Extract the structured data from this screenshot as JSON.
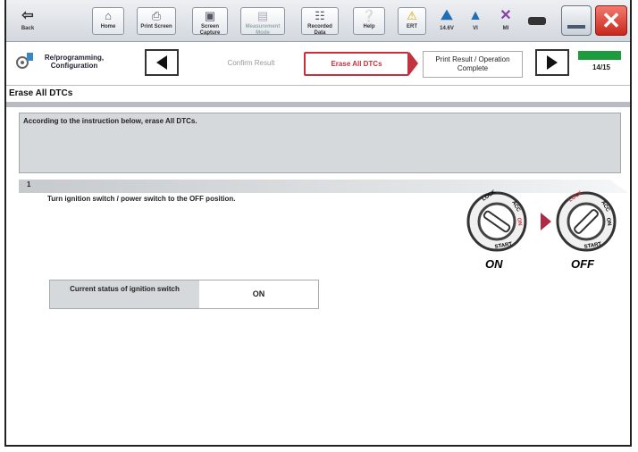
{
  "toolbar": {
    "back_label": "Back",
    "home_label": "Home",
    "print_screen_label": "Print Screen",
    "screen_capture_label": "Screen Capture",
    "measurement_mode_label": "Measurement Mode",
    "recorded_data_label": "Recorded Data",
    "help_label": "Help",
    "ert_label": "ERT",
    "voltage_label": "14.6V",
    "vi_label": "VI",
    "mi_label": "MI"
  },
  "stepnav": {
    "procedure_label": "Re/programming, Configuration",
    "prev_step": "Confirm Result",
    "current_step": "Erase All DTCs",
    "next_step": "Print Result / Operation Complete",
    "step_counter": "14/15",
    "progress_fraction": 0.93
  },
  "page": {
    "title": "Erase All DTCs",
    "instruction": "According to the instruction below, erase All DTCs.",
    "step_number": "1",
    "step_text": "Turn ignition switch / power switch to the OFF position.",
    "graphic": {
      "on_label": "ON",
      "off_label": "OFF",
      "lock_text": "LOCK",
      "acc_text": "ACC",
      "on_text": "ON",
      "start_text": "START"
    },
    "status": {
      "label": "Current status of ignition switch",
      "value": "ON"
    }
  },
  "colors": {
    "accent_red": "#c2323f",
    "progress_green": "#1c9c3c",
    "close_red": "#c9271b"
  }
}
